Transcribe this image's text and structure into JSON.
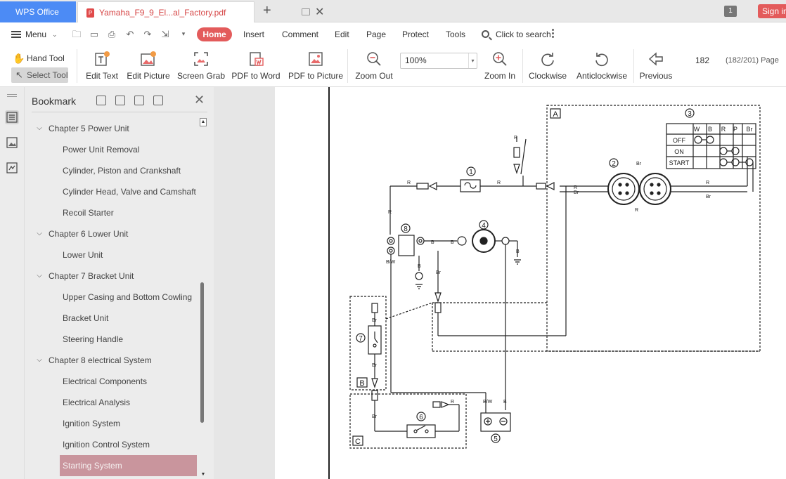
{
  "titlebar": {
    "app_tab": "WPS Office",
    "doc_tab": "Yamaha_F9_9_El...al_Factory.pdf",
    "window_count": "1",
    "signin": "Sign in"
  },
  "menu": {
    "menu_label": "Menu",
    "tabs": [
      "Home",
      "Insert",
      "Comment",
      "Edit",
      "Page",
      "Protect",
      "Tools"
    ],
    "search_placeholder": "Click to search"
  },
  "toolbar": {
    "hand_tool": "Hand Tool",
    "select_tool": "Select Tool",
    "edit_text": "Edit Text",
    "edit_picture": "Edit Picture",
    "screen_grab": "Screen Grab",
    "pdf_to_word": "PDF to Word",
    "pdf_to_picture": "PDF to Picture",
    "zoom_out": "Zoom Out",
    "zoom_value": "100%",
    "zoom_in": "Zoom In",
    "clockwise": "Clockwise",
    "anticlockwise": "Anticlockwise",
    "previous": "Previous",
    "page_number": "182",
    "page_count": "(182/201) Page"
  },
  "bookmark": {
    "title": "Bookmark",
    "items": [
      {
        "label": "Chapter 5 Power Unit",
        "level": 0,
        "expanded": true
      },
      {
        "label": "Power Unit  Removal",
        "level": 1
      },
      {
        "label": "Cylinder, Piston and Crankshaft",
        "level": 1
      },
      {
        "label": "Cylinder Head, Valve and Camshaft",
        "level": 1
      },
      {
        "label": "Recoil Starter",
        "level": 1
      },
      {
        "label": "Chapter 6 Lower Unit",
        "level": 0,
        "expanded": true
      },
      {
        "label": "Lower Unit",
        "level": 1
      },
      {
        "label": "Chapter 7 Bracket Unit",
        "level": 0,
        "expanded": true
      },
      {
        "label": "Upper Casing and Bottom Cowling",
        "level": 1
      },
      {
        "label": "Bracket Unit",
        "level": 1
      },
      {
        "label": "Steering Handle",
        "level": 1
      },
      {
        "label": "Chapter 8 electrical System",
        "level": 0,
        "expanded": true
      },
      {
        "label": "Electrical Components",
        "level": 1
      },
      {
        "label": "Electrical Analysis",
        "level": 1
      },
      {
        "label": "Ignition System",
        "level": 1
      },
      {
        "label": "Ignition Control System",
        "level": 1
      },
      {
        "label": "Starting System",
        "level": 1,
        "selected": true
      }
    ]
  },
  "diagram": {
    "box_a": "A",
    "box_b": "B",
    "box_c": "C",
    "switch_header": [
      "W",
      "B",
      "R",
      "P",
      "Br"
    ],
    "switch_rows": [
      "OFF",
      "ON",
      "START"
    ],
    "n1": "1",
    "n2": "2",
    "n3": "3",
    "n4": "4",
    "n5": "5",
    "n6": "6",
    "n7": "7",
    "n8": "8",
    "wire_r": "R",
    "wire_b": "B",
    "wire_br": "Br",
    "wire_bw": "B/W"
  },
  "colors": {
    "accent": "#e35b5b",
    "wps_blue": "#4c8bf5",
    "selected_bookmark": "#c9959d"
  }
}
